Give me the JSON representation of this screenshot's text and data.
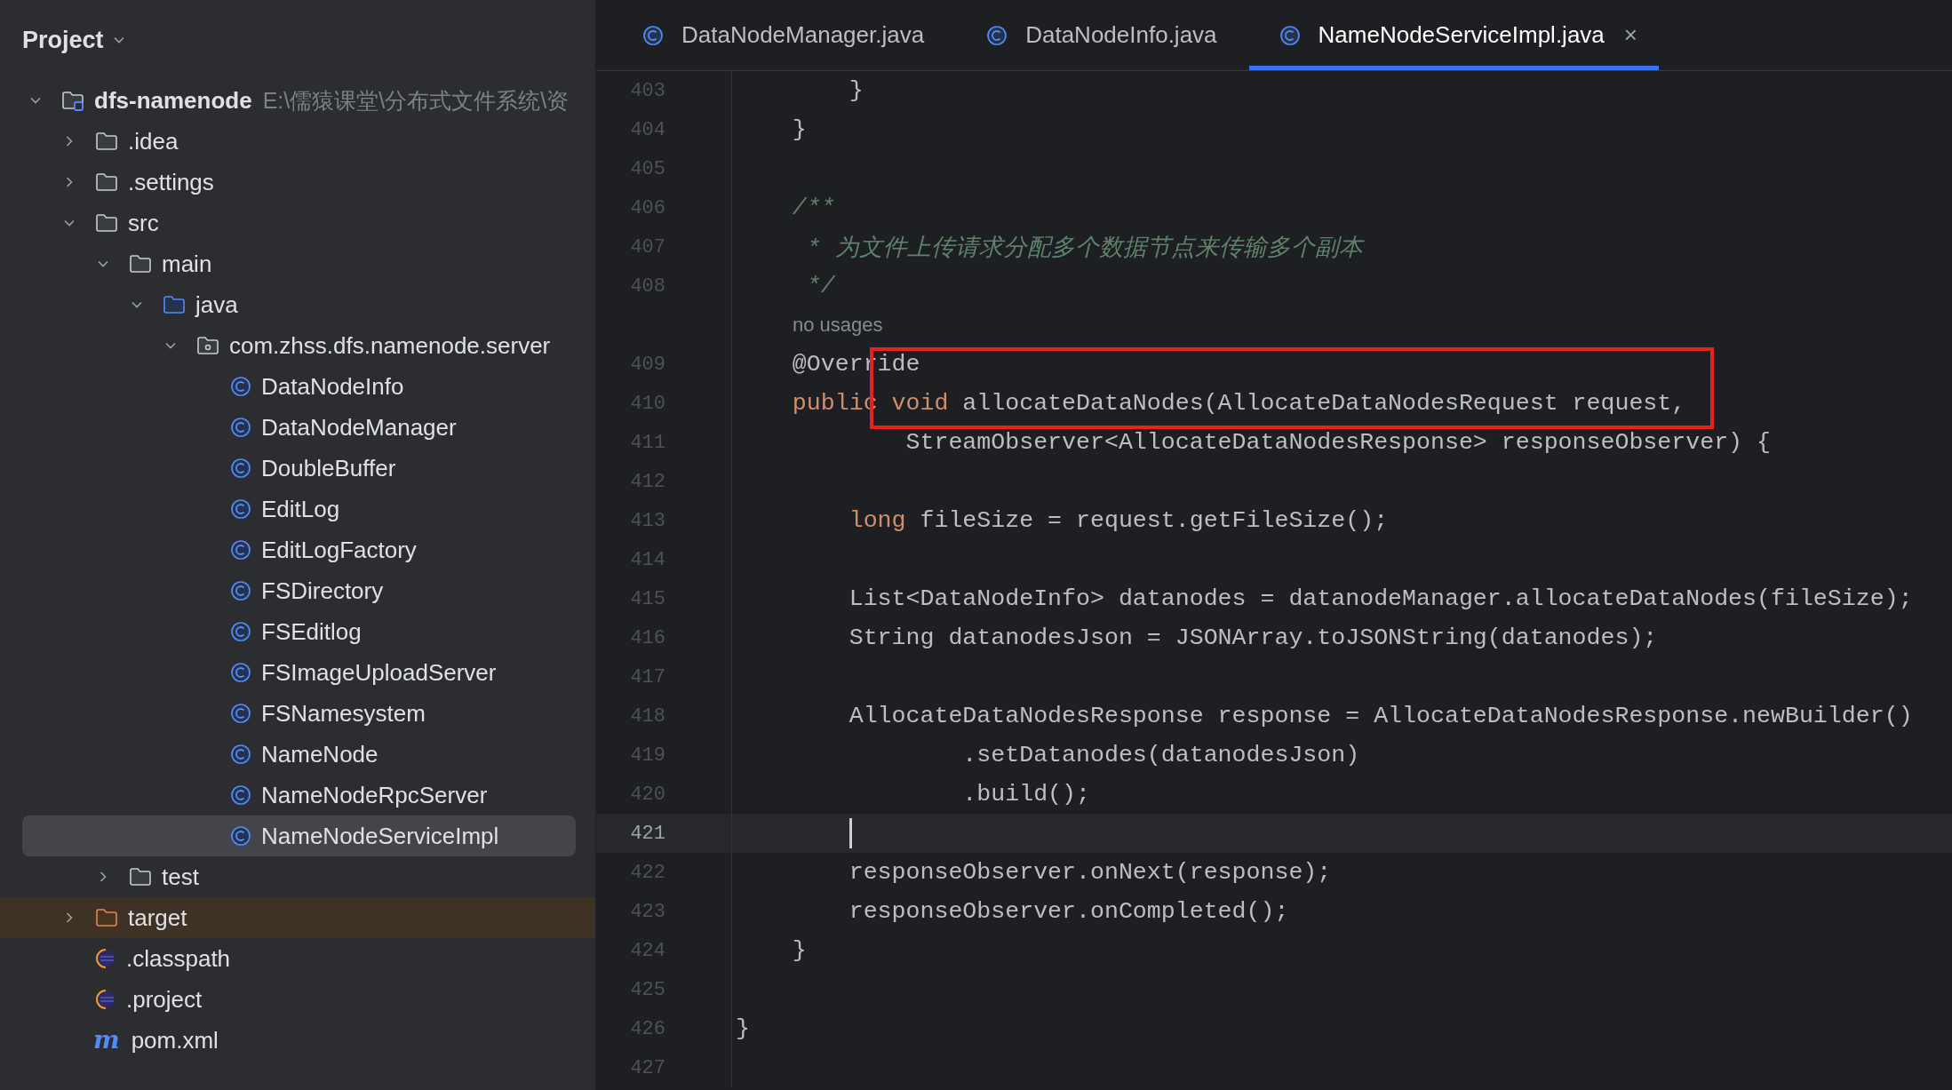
{
  "sidebar": {
    "title": "Project",
    "tree": [
      {
        "kind": "module",
        "label": "dfs-namenode",
        "path": "E:\\儒猿课堂\\分布式文件系统\\资",
        "expanded": true,
        "selected": false,
        "children": [
          {
            "kind": "folder",
            "label": ".idea",
            "expanded": false,
            "selected": false
          },
          {
            "kind": "folder",
            "label": ".settings",
            "expanded": false,
            "selected": false
          },
          {
            "kind": "folder",
            "label": "src",
            "expanded": true,
            "selected": false,
            "children": [
              {
                "kind": "folder",
                "label": "main",
                "expanded": true,
                "selected": false,
                "children": [
                  {
                    "kind": "source-folder",
                    "label": "java",
                    "expanded": true,
                    "selected": false,
                    "children": [
                      {
                        "kind": "package",
                        "label": "com.zhss.dfs.namenode.server",
                        "expanded": true,
                        "selected": false,
                        "children": [
                          {
                            "kind": "class",
                            "label": "DataNodeInfo",
                            "selected": false
                          },
                          {
                            "kind": "class",
                            "label": "DataNodeManager",
                            "selected": false
                          },
                          {
                            "kind": "class",
                            "label": "DoubleBuffer",
                            "selected": false
                          },
                          {
                            "kind": "class",
                            "label": "EditLog",
                            "selected": false
                          },
                          {
                            "kind": "class",
                            "label": "EditLogFactory",
                            "selected": false
                          },
                          {
                            "kind": "class",
                            "label": "FSDirectory",
                            "selected": false
                          },
                          {
                            "kind": "class",
                            "label": "FSEditlog",
                            "selected": false
                          },
                          {
                            "kind": "class",
                            "label": "FSImageUploadServer",
                            "selected": false
                          },
                          {
                            "kind": "class",
                            "label": "FSNamesystem",
                            "selected": false
                          },
                          {
                            "kind": "class",
                            "label": "NameNode",
                            "selected": false
                          },
                          {
                            "kind": "class",
                            "label": "NameNodeRpcServer",
                            "selected": false
                          },
                          {
                            "kind": "class",
                            "label": "NameNodeServiceImpl",
                            "selected": true
                          }
                        ]
                      }
                    ]
                  }
                ]
              },
              {
                "kind": "folder",
                "label": "test",
                "expanded": false,
                "selected": false
              }
            ]
          },
          {
            "kind": "excluded-folder",
            "label": "target",
            "expanded": false,
            "selected": false
          },
          {
            "kind": "eclipse-file",
            "label": ".classpath",
            "selected": false
          },
          {
            "kind": "eclipse-file",
            "label": ".project",
            "selected": false
          },
          {
            "kind": "maven-file",
            "label": "pom.xml",
            "glyph": "m",
            "selected": false
          }
        ]
      }
    ]
  },
  "tabs": [
    {
      "label": "DataNodeManager.java",
      "selected": false
    },
    {
      "label": "DataNodeInfo.java",
      "selected": false
    },
    {
      "label": "NameNodeServiceImpl.java",
      "selected": true,
      "close": "×"
    }
  ],
  "editor": {
    "lines": [
      {
        "number": "403",
        "current": false,
        "tokens": [
          {
            "kind": "plain",
            "text": "        }"
          }
        ]
      },
      {
        "number": "404",
        "current": false,
        "tokens": [
          {
            "kind": "plain",
            "text": "    }"
          }
        ]
      },
      {
        "number": "405",
        "current": false
      },
      {
        "number": "406",
        "current": false,
        "tokens": [
          {
            "kind": "comment",
            "text": "    /**"
          }
        ]
      },
      {
        "number": "407",
        "current": false,
        "tokens": [
          {
            "kind": "comment",
            "text": "     * 为文件上传请求分配多个数据节点来传输多个副本"
          }
        ]
      },
      {
        "number": "408",
        "current": false,
        "tokens": [
          {
            "kind": "comment",
            "text": "     */"
          }
        ]
      },
      {
        "kind": "hint",
        "text": "no usages"
      },
      {
        "number": "409",
        "current": false,
        "tokens": [
          {
            "kind": "plain",
            "text": "    @Override"
          }
        ]
      },
      {
        "number": "410",
        "current": false,
        "tokens": [
          {
            "kind": "keyword",
            "text": "    public"
          },
          {
            "kind": "keyword",
            "text": " void"
          },
          {
            "kind": "plain",
            "text": " allocateDataNodes(AllocateDataNodesRequest request,"
          }
        ]
      },
      {
        "number": "411",
        "current": false,
        "tokens": [
          {
            "kind": "plain",
            "text": "            StreamObserver<AllocateDataNodesResponse> responseObserver) {"
          }
        ]
      },
      {
        "number": "412",
        "current": false
      },
      {
        "number": "413",
        "current": false,
        "tokens": [
          {
            "kind": "keyword",
            "text": "        long"
          },
          {
            "kind": "plain",
            "text": " fileSize = request.getFileSize();"
          }
        ]
      },
      {
        "number": "414",
        "current": false
      },
      {
        "number": "415",
        "current": false,
        "tokens": [
          {
            "kind": "plain",
            "text": "        List<DataNodeInfo> datanodes = datanodeManager.allocateDataNodes(fileSize);"
          }
        ]
      },
      {
        "number": "416",
        "current": false,
        "tokens": [
          {
            "kind": "plain",
            "text": "        String datanodesJson = JSONArray.toJSONString(datanodes);"
          }
        ]
      },
      {
        "number": "417",
        "current": false
      },
      {
        "number": "418",
        "current": false,
        "tokens": [
          {
            "kind": "plain",
            "text": "        AllocateDataNodesResponse response = AllocateDataNodesResponse.newBuilder()"
          }
        ]
      },
      {
        "number": "419",
        "current": false,
        "tokens": [
          {
            "kind": "plain",
            "text": "                .setDatanodes(datanodesJson)"
          }
        ]
      },
      {
        "number": "420",
        "current": false,
        "tokens": [
          {
            "kind": "plain",
            "text": "                .build();"
          }
        ]
      },
      {
        "number": "421",
        "current": true
      },
      {
        "number": "422",
        "current": false,
        "tokens": [
          {
            "kind": "plain",
            "text": "        responseObserver.onNext(response);"
          }
        ]
      },
      {
        "number": "423",
        "current": false,
        "tokens": [
          {
            "kind": "plain",
            "text": "        responseObserver.onCompleted();"
          }
        ]
      },
      {
        "number": "424",
        "current": false,
        "tokens": [
          {
            "kind": "plain",
            "text": "    }"
          }
        ]
      },
      {
        "number": "425",
        "current": false
      },
      {
        "number": "426",
        "current": false,
        "tokens": [
          {
            "kind": "plain",
            "text": "}"
          }
        ]
      },
      {
        "number": "427",
        "current": false
      }
    ]
  }
}
